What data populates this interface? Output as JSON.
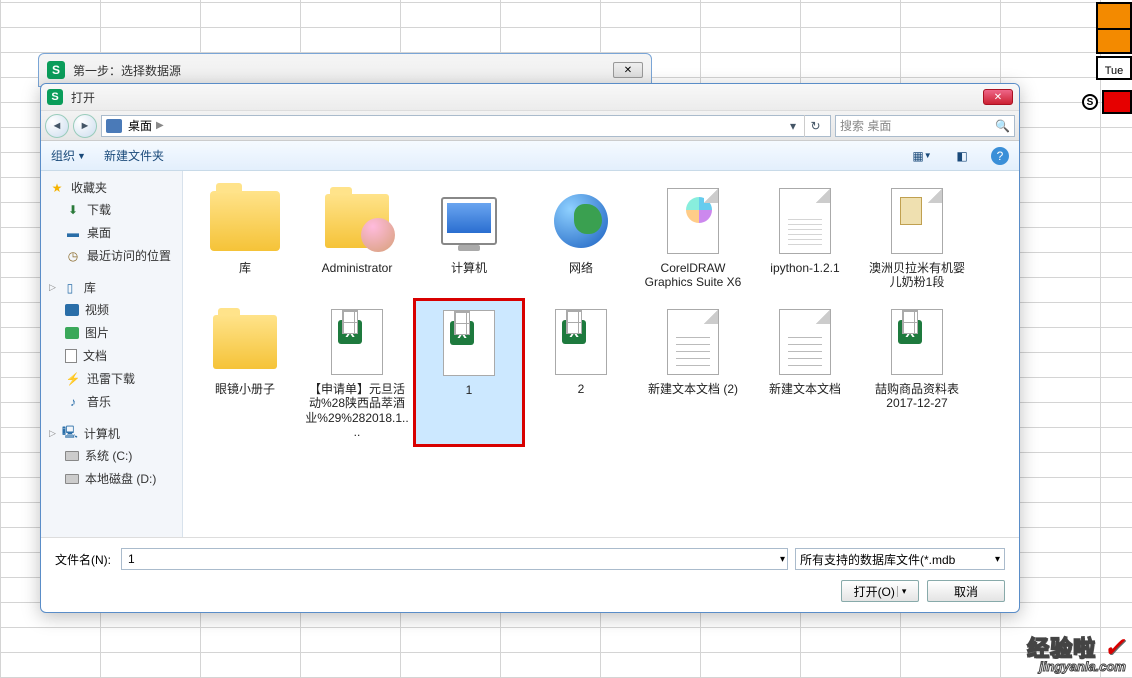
{
  "parent_dialog": {
    "title": "第一步：选择数据源"
  },
  "dialog": {
    "title": "打开"
  },
  "breadcrumb": {
    "location": "桌面",
    "sep": "▶"
  },
  "search": {
    "placeholder": "搜索 桌面"
  },
  "toolbar": {
    "organize": "组织",
    "new_folder": "新建文件夹"
  },
  "sidebar": {
    "favorites": {
      "header": "收藏夹",
      "items": [
        {
          "label": "下载"
        },
        {
          "label": "桌面"
        },
        {
          "label": "最近访问的位置"
        }
      ]
    },
    "libraries": {
      "header": "库",
      "items": [
        {
          "label": "视频"
        },
        {
          "label": "图片"
        },
        {
          "label": "文档"
        },
        {
          "label": "迅雷下载"
        },
        {
          "label": "音乐"
        }
      ]
    },
    "computer": {
      "header": "计算机",
      "items": [
        {
          "label": "系统 (C:)"
        },
        {
          "label": "本地磁盘 (D:)"
        }
      ]
    }
  },
  "files": [
    {
      "name": "库",
      "type": "lib"
    },
    {
      "name": "Administrator",
      "type": "user"
    },
    {
      "name": "计算机",
      "type": "pc"
    },
    {
      "name": "网络",
      "type": "net"
    },
    {
      "name": "CorelDRAW Graphics Suite X6",
      "type": "cd"
    },
    {
      "name": "ipython-1.2.1",
      "type": "py"
    },
    {
      "name": "澳洲贝拉米有机婴儿奶粉1段",
      "type": "rtf"
    },
    {
      "name": "眼镜小册子",
      "type": "folder"
    },
    {
      "name": "【申请单】元旦活动%28陕西品萃酒业%29%282018.1....",
      "type": "xls"
    },
    {
      "name": "1",
      "type": "xls",
      "selected": true,
      "highlighted": true
    },
    {
      "name": "2",
      "type": "xls"
    },
    {
      "name": "新建文本文档 (2)",
      "type": "txt"
    },
    {
      "name": "新建文本文档",
      "type": "txt"
    },
    {
      "name": "喆购商品资料表2017-12-27",
      "type": "xls"
    }
  ],
  "bottom": {
    "filename_label": "文件名(N):",
    "filename_value": "1",
    "filter": "所有支持的数据库文件(*.mdb",
    "open": "打开(O)",
    "cancel": "取消"
  },
  "deco": {
    "tue": "Tue",
    "s": "S"
  },
  "watermark": {
    "line1": "经验啦",
    "line2": "jingyanla.com"
  }
}
